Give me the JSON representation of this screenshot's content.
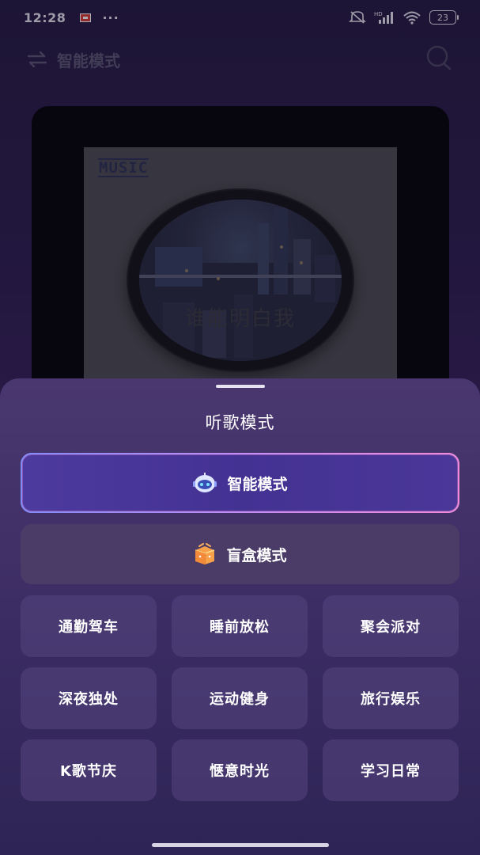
{
  "status_bar": {
    "time": "12:28",
    "more": "···",
    "battery": "23"
  },
  "header": {
    "mode_label": "智能模式"
  },
  "album": {
    "logo": "MUSIC",
    "song_title": "谁能明白我"
  },
  "sheet": {
    "title": "听歌模式",
    "primary_mode": "智能模式",
    "secondary_mode": "盲盒模式",
    "scenes": [
      "通勤驾车",
      "睡前放松",
      "聚会派对",
      "深夜独处",
      "运动健身",
      "旅行娱乐",
      "K歌节庆",
      "惬意时光",
      "学习日常"
    ]
  },
  "colors": {
    "accent_border": "#b69cf7",
    "selected_bg": "#4d3a9e",
    "sheet_bg": "#3a2c62"
  }
}
